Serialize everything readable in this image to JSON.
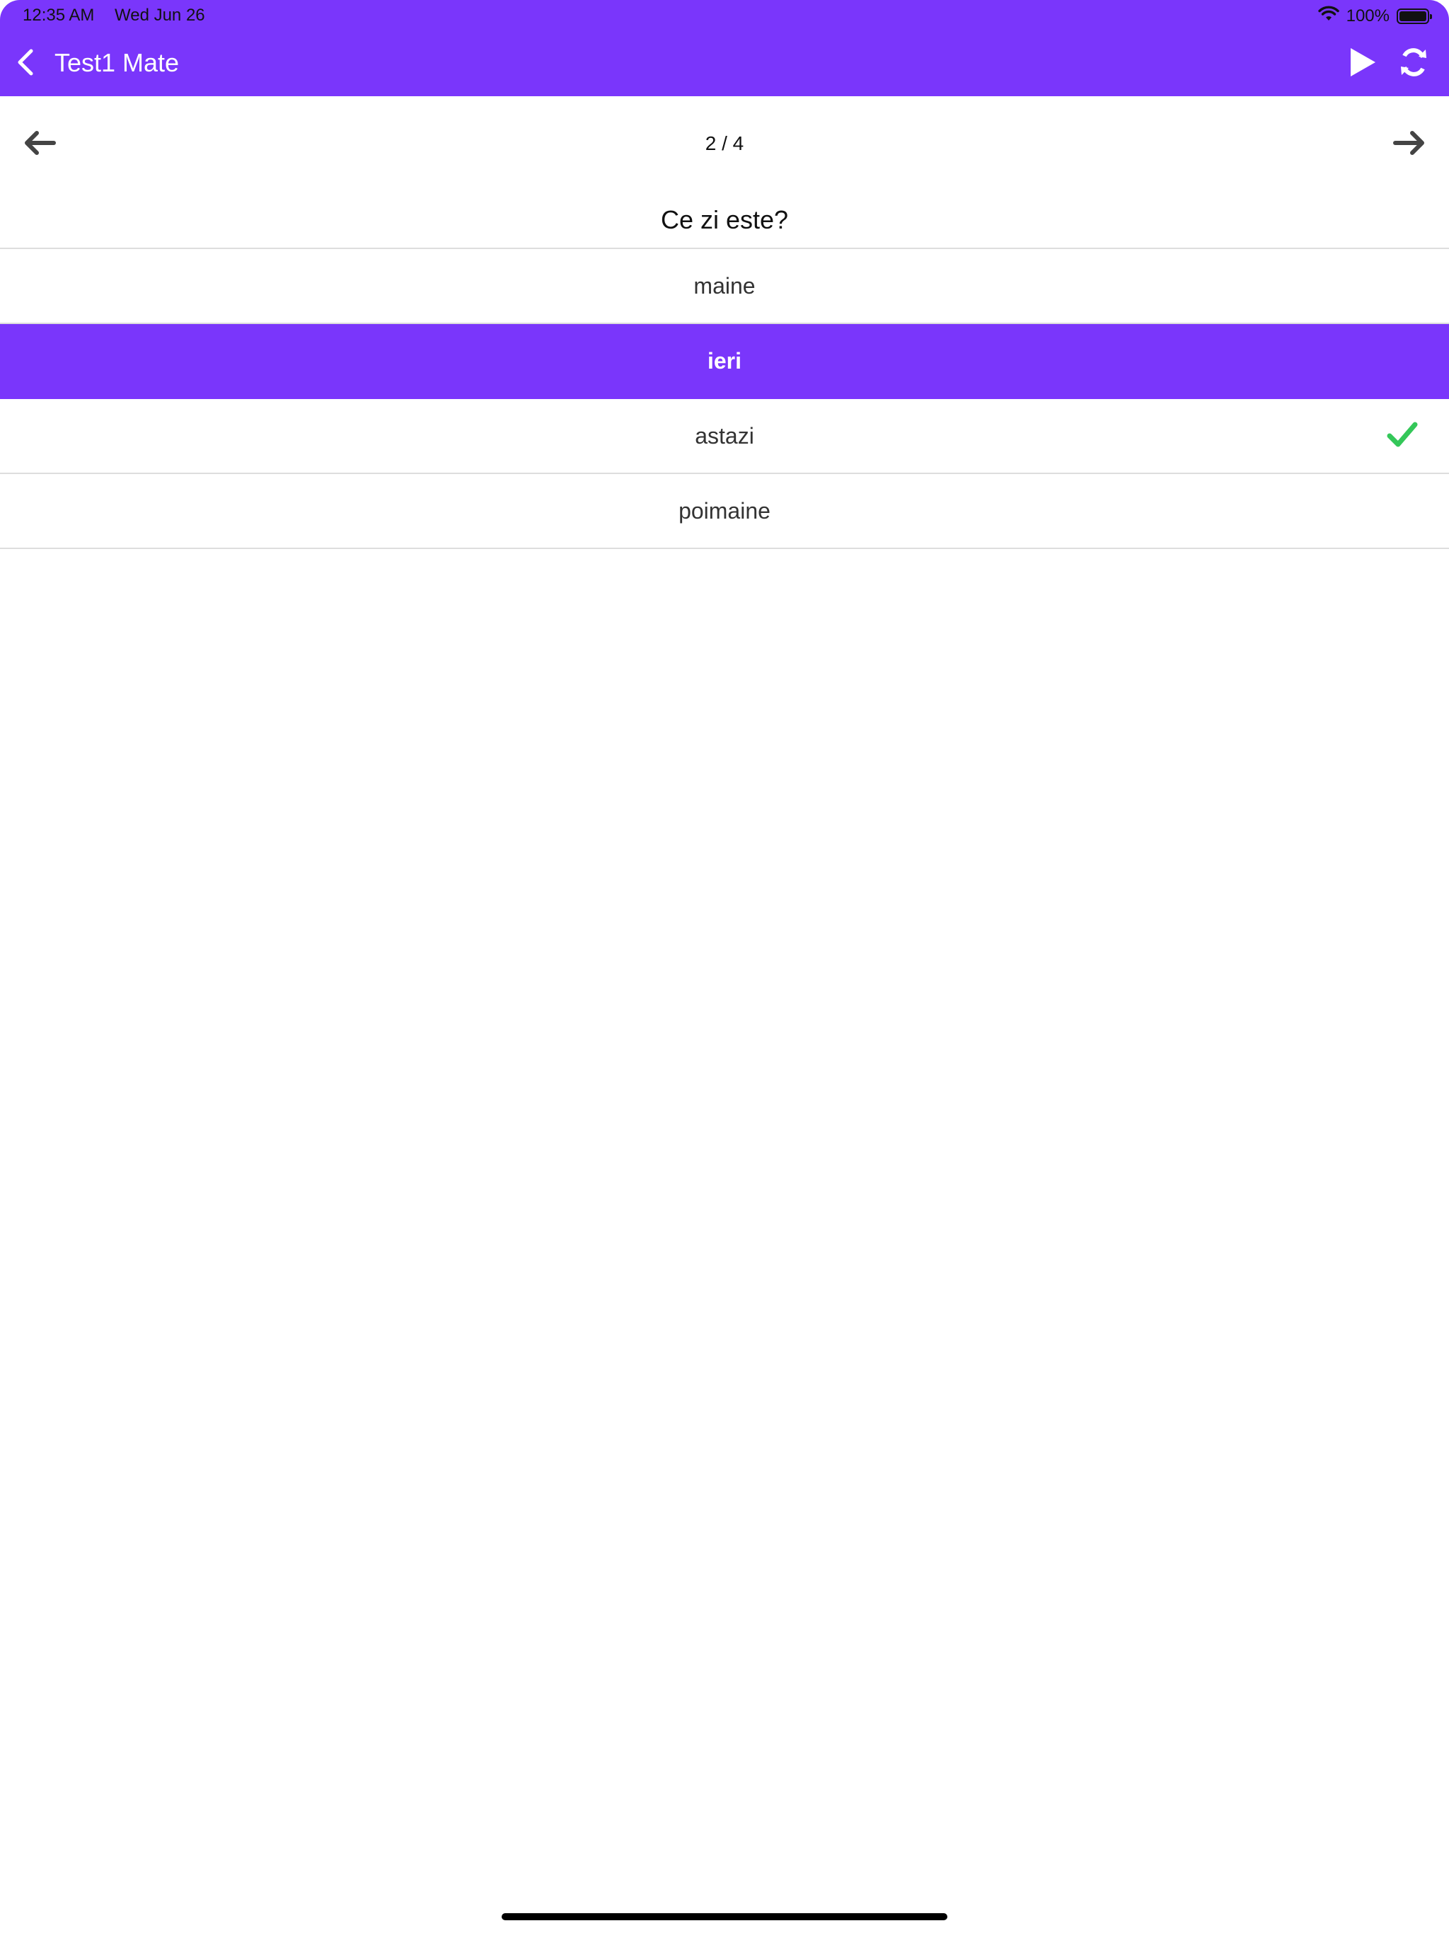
{
  "status_bar": {
    "time": "12:35 AM",
    "date": "Wed Jun 26",
    "battery": "100%",
    "battery_level": 1.0,
    "icons": [
      "wifi-icon",
      "battery-icon"
    ]
  },
  "nav": {
    "title": "Test1 Mate",
    "back_icon": "chevron-left-icon",
    "play_icon": "play-icon",
    "refresh_icon": "refresh-icon"
  },
  "pager": {
    "indicator": "2 / 4",
    "prev_icon": "arrow-left-icon",
    "next_icon": "arrow-right-icon"
  },
  "question": {
    "text": "Ce zi este?"
  },
  "options": [
    {
      "label": "maine",
      "selected": false,
      "correct": false
    },
    {
      "label": "ieri",
      "selected": true,
      "correct": false
    },
    {
      "label": "astazi",
      "selected": false,
      "correct": true
    },
    {
      "label": "poimaine",
      "selected": false,
      "correct": false
    }
  ],
  "colors": {
    "accent": "#7a36fb",
    "correct": "#34c759",
    "divider": "#dddddd",
    "icon_dark": "#444444"
  }
}
